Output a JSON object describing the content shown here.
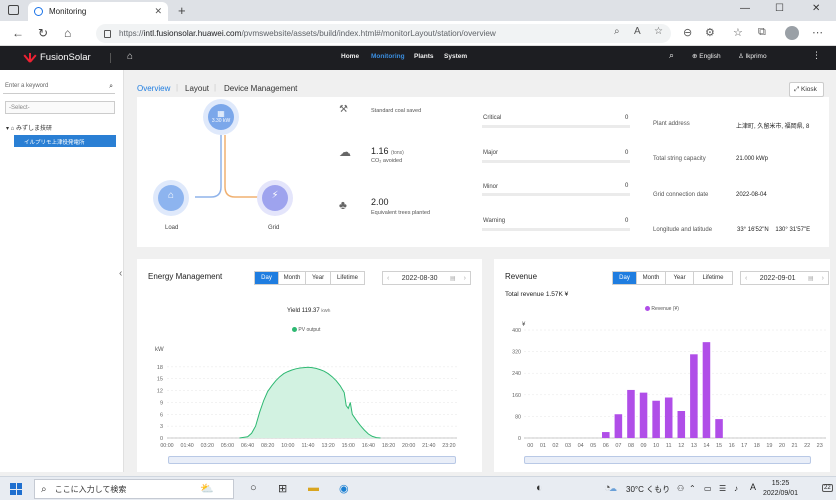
{
  "browser": {
    "tab_title": "Monitoring",
    "url_prefix": "https://",
    "url_domain": "intl.fusionsolar.huawei.com",
    "url_path": "/pvmswebsite/assets/build/index.html#/monitorLayout/station/overview"
  },
  "header": {
    "brand": "FusionSolar",
    "menu": [
      "Home",
      "Monitoring",
      "Plants",
      "System"
    ],
    "active_menu": "Monitoring",
    "language": "English",
    "user": "lkprimo"
  },
  "sidebar": {
    "search_placeholder": "Enter a keyword",
    "select_placeholder": "-Select-",
    "tree": {
      "company": "みずしま技研",
      "station": "イルプリモ上津役発電所"
    }
  },
  "main_tabs": [
    "Overview",
    "Layout",
    "Device Management"
  ],
  "kiosk_label": "Kiosk",
  "flow": {
    "pv_power_label": "3.30 kW",
    "load_label": "Load",
    "grid_label": "Grid"
  },
  "env_benefits": [
    {
      "value": "",
      "unit": "",
      "label": "Standard coal saved"
    },
    {
      "value": "1.16",
      "unit": "(tons)",
      "label": "CO₂ avoided"
    },
    {
      "value": "2.00",
      "unit": "",
      "label": "Equivalent trees planted"
    }
  ],
  "alarms": [
    {
      "label": "Critical",
      "count": "0"
    },
    {
      "label": "Major",
      "count": "0"
    },
    {
      "label": "Minor",
      "count": "0"
    },
    {
      "label": "Warning",
      "count": "0"
    }
  ],
  "plant_info": [
    {
      "label": "Plant address",
      "value": "上津町, 久留米市, 福岡県, 8"
    },
    {
      "label": "Total string capacity",
      "value": "21.000 kWp"
    },
    {
      "label": "Grid connection date",
      "value": "2022-08-04"
    },
    {
      "label": "Longitude and latitude",
      "value": "33° 16'52\"N    130° 31'57\"E"
    }
  ],
  "energy": {
    "title": "Energy Management",
    "periods": [
      "Day",
      "Month",
      "Year",
      "Lifetime"
    ],
    "active_period": "Day",
    "date": "2022-08-30",
    "yield_label": "Yield 119.37",
    "yield_unit": "kWh",
    "legend": "PV output",
    "ylabel": "kW",
    "colors": {
      "line": "#2eb872",
      "fill": "#d2f2e1"
    }
  },
  "revenue": {
    "title": "Revenue",
    "periods": [
      "Day",
      "Month",
      "Year",
      "Lifetime"
    ],
    "active_period": "Day",
    "date": "2022-09-01",
    "total_label": "Total revenue 1.57K ¥",
    "legend": "Revenue (¥)",
    "ylabel": "¥",
    "colors": {
      "bar": "#b04ee8"
    }
  },
  "chart_data": [
    {
      "type": "area",
      "title": "Energy Management",
      "ylabel": "kW",
      "ylim": [
        0,
        21
      ],
      "yticks": [
        0,
        3,
        6,
        9,
        12,
        15,
        18
      ],
      "xticks": [
        "00:00",
        "01:40",
        "03:20",
        "05:00",
        "06:40",
        "08:20",
        "10:00",
        "11:40",
        "13:20",
        "15:00",
        "16:40",
        "18:20",
        "20:00",
        "21:40",
        "23:20"
      ],
      "series": [
        {
          "name": "PV output",
          "x": [
            "06:00",
            "06:40",
            "07:00",
            "07:20",
            "07:40",
            "08:00",
            "08:20",
            "08:40",
            "09:00",
            "09:20",
            "09:40",
            "10:00",
            "10:20",
            "10:40",
            "11:00",
            "11:20",
            "11:40",
            "12:00",
            "12:20",
            "12:40",
            "13:00",
            "13:20",
            "13:40",
            "14:00",
            "14:20",
            "14:40",
            "14:50",
            "15:00",
            "15:10",
            "15:20",
            "15:40",
            "16:00",
            "16:20",
            "16:40",
            "17:00",
            "17:20",
            "17:40"
          ],
          "values": [
            0,
            0.3,
            1.2,
            3.0,
            6.5,
            9.5,
            11.8,
            13.2,
            14.5,
            15.5,
            16.3,
            16.8,
            17.2,
            17.5,
            17.7,
            17.8,
            17.9,
            17.8,
            17.6,
            17.3,
            16.9,
            16.3,
            15.5,
            14.5,
            13.2,
            11.5,
            8.2,
            7.5,
            9.0,
            6.0,
            4.5,
            3.2,
            2.0,
            1.0,
            0.4,
            0.1,
            0
          ]
        }
      ]
    },
    {
      "type": "bar",
      "title": "Revenue",
      "ylabel": "¥",
      "ylim": [
        0,
        400
      ],
      "yticks": [
        0,
        80,
        160,
        240,
        320,
        400
      ],
      "categories": [
        "00",
        "01",
        "02",
        "03",
        "04",
        "05",
        "06",
        "07",
        "08",
        "09",
        "10",
        "11",
        "12",
        "13",
        "14",
        "15",
        "16",
        "17",
        "18",
        "19",
        "20",
        "21",
        "22",
        "23"
      ],
      "series": [
        {
          "name": "Revenue (¥)",
          "values": [
            0,
            0,
            0,
            0,
            0,
            0,
            22,
            88,
            178,
            168,
            138,
            150,
            100,
            310,
            355,
            70,
            0,
            0,
            0,
            0,
            0,
            0,
            0,
            0
          ]
        }
      ]
    }
  ],
  "taskbar": {
    "search_placeholder": "ここに入力して検索",
    "weather": "30°C くもり",
    "ime": "A",
    "time": "15:25",
    "date": "2022/09/01",
    "notifications": "22"
  }
}
